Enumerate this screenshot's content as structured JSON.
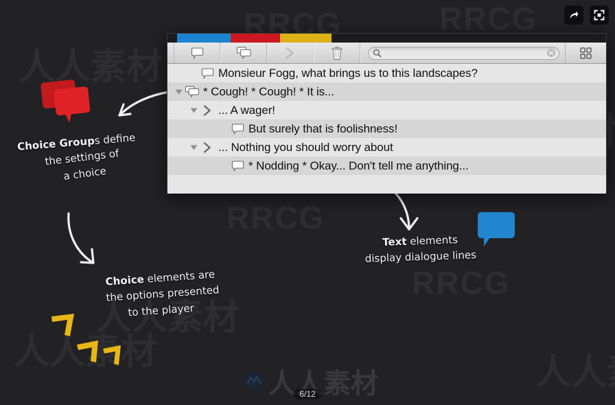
{
  "window": {
    "tabs": [
      {
        "name": "tab-blue",
        "color": "#1b84d0"
      },
      {
        "name": "tab-red",
        "color": "#cc1820"
      },
      {
        "name": "tab-yellow",
        "color": "#dcb216"
      }
    ],
    "toolbar": {
      "buttons": [
        {
          "name": "add-text-button",
          "icon": "speech-bubble-icon",
          "enabled": true
        },
        {
          "name": "add-choice-group-button",
          "icon": "double-speech-bubble-icon",
          "enabled": true
        },
        {
          "name": "add-choice-button",
          "icon": "chevron-right-icon",
          "enabled": false
        },
        {
          "name": "delete-button",
          "icon": "trash-icon",
          "enabled": true
        }
      ],
      "search": {
        "value": "",
        "placeholder": "",
        "icon": "search-icon",
        "clear_icon": "clear-circle-icon"
      },
      "grid_button": {
        "name": "grid-view-button",
        "icon": "grid-icon"
      }
    },
    "rows": [
      {
        "indent": 1,
        "disclosure": "none",
        "icon": "speech-bubble-icon",
        "text": "Monsieur Fogg, what brings us to this landscapes?",
        "stripe": "plain"
      },
      {
        "indent": 0,
        "disclosure": "open",
        "icon": "double-speech-bubble-icon",
        "text": "* Cough! * Cough! * It is...",
        "stripe": "alt"
      },
      {
        "indent": 1,
        "disclosure": "open",
        "icon": "chevron-right-icon",
        "text": "... A wager!",
        "stripe": "plain"
      },
      {
        "indent": 3,
        "disclosure": "none",
        "icon": "speech-bubble-icon",
        "text": "But surely that is foolishness!",
        "stripe": "alt"
      },
      {
        "indent": 1,
        "disclosure": "open",
        "icon": "chevron-right-icon",
        "text": "... Nothing you should worry about",
        "stripe": "plain"
      },
      {
        "indent": 3,
        "disclosure": "none",
        "icon": "speech-bubble-icon",
        "text": "* Nodding * Okay... Don't tell me anything...",
        "stripe": "alt"
      }
    ]
  },
  "annotations": {
    "choice_group": {
      "line1_bold": "Choice Group",
      "line1_rest": "s define",
      "line2": "the settings of",
      "line3": "a choice"
    },
    "choice": {
      "line1_bold": "Choice",
      "line1_rest": " elements are",
      "line2": "the options presented",
      "line3": "to the player"
    },
    "text": {
      "line1_bold": "Text",
      "line1_rest": " elements",
      "line2": "display dialogue lines"
    }
  },
  "overlay": {
    "share_button": {
      "name": "share-button",
      "icon": "share-arrow-icon"
    },
    "fullscreen_button": {
      "name": "fullscreen-button",
      "icon": "fullscreen-icon"
    },
    "page_indicator": "6/12"
  },
  "watermarks": {
    "latin": "RRCG",
    "cjk": "人人素材"
  },
  "colors": {
    "background": "#222124",
    "tab_blue": "#1b84d0",
    "tab_red": "#cc1820",
    "tab_yellow": "#dcb216",
    "bubble_red": "#d81f22",
    "bubble_blue": "#2186cf",
    "chevron_yellow": "#e8b616",
    "annotation_text": "#f2f2f2"
  }
}
